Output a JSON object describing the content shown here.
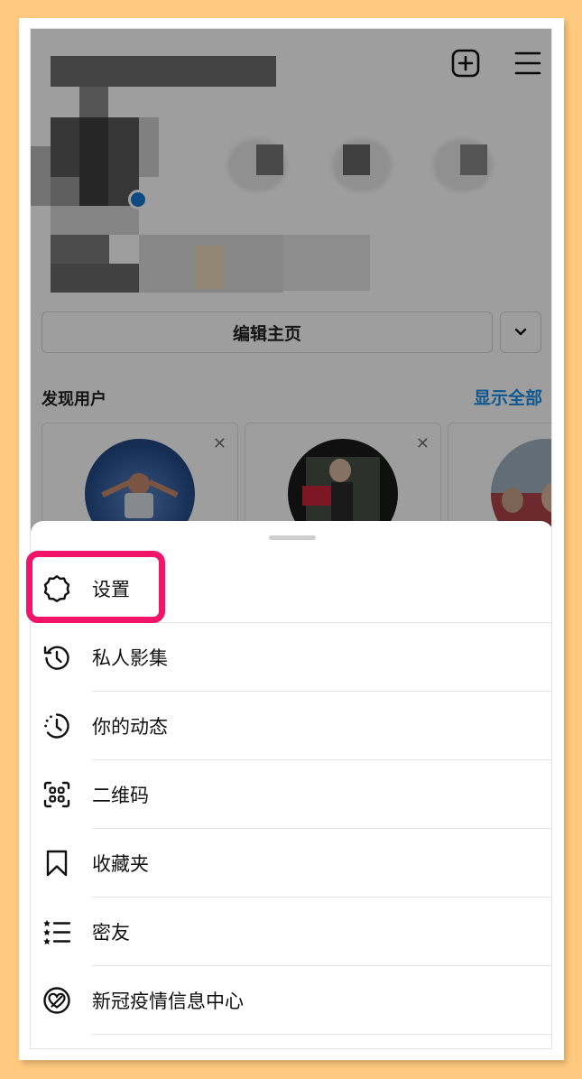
{
  "profile": {
    "edit_button_label": "编辑主页",
    "discover_title": "发现用户",
    "discover_show_all": "显示全部",
    "dismiss_symbol": "✕"
  },
  "menu": {
    "items": [
      {
        "label": "设置",
        "icon": "gear-icon"
      },
      {
        "label": "私人影集",
        "icon": "history-icon"
      },
      {
        "label": "你的动态",
        "icon": "activity-icon"
      },
      {
        "label": "二维码",
        "icon": "qr-code-icon"
      },
      {
        "label": "收藏夹",
        "icon": "bookmark-icon"
      },
      {
        "label": "密友",
        "icon": "close-friends-icon"
      },
      {
        "label": "新冠疫情信息中心",
        "icon": "covid-info-icon"
      }
    ]
  },
  "colors": {
    "background": "#FFCA7F",
    "highlight": "#F0146B",
    "link": "#1a8fe8"
  }
}
